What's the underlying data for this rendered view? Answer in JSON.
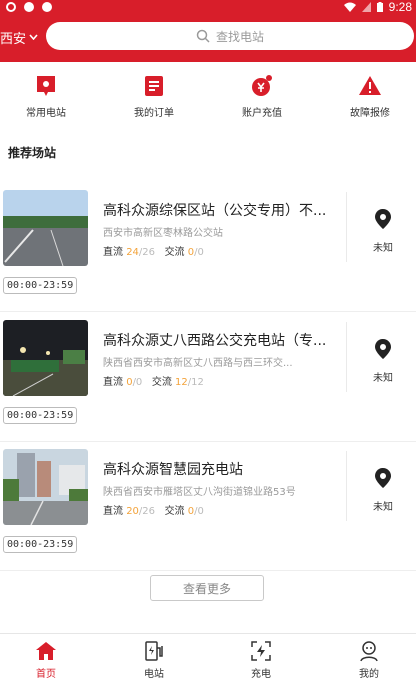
{
  "status_bar": {
    "time": "9:28"
  },
  "header": {
    "city": "西安",
    "search_placeholder": "查找电站"
  },
  "quick_actions": [
    {
      "label": "常用电站",
      "icon": "bookmark-station-icon"
    },
    {
      "label": "我的订单",
      "icon": "order-list-icon"
    },
    {
      "label": "账户充值",
      "icon": "wallet-recharge-icon"
    },
    {
      "label": "故障报修",
      "icon": "warning-icon"
    }
  ],
  "section_title": "推荐场站",
  "stations": [
    {
      "name": "高科众源综保区站（公交专用）不...",
      "address": "西安市高新区枣林路公交站",
      "dc_label": "直流",
      "dc_available": "24",
      "dc_total": "/26",
      "ac_label": "交流",
      "ac_available": "0",
      "ac_total": "/0",
      "distance_status": "未知",
      "hours": "00:00-23:59"
    },
    {
      "name": "高科众源丈八西路公交充电站（专...",
      "address": "陕西省西安市高新区丈八西路与西三环交...",
      "dc_label": "直流",
      "dc_available": "0",
      "dc_total": "/0",
      "ac_label": "交流",
      "ac_available": "12",
      "ac_total": "/12",
      "distance_status": "未知",
      "hours": "00:00-23:59"
    },
    {
      "name": "高科众源智慧园充电站",
      "address": "陕西省西安市雁塔区丈八沟街道锦业路53号",
      "dc_label": "直流",
      "dc_available": "20",
      "dc_total": "/26",
      "ac_label": "交流",
      "ac_available": "0",
      "ac_total": "/0",
      "distance_status": "未知",
      "hours": "00:00-23:59"
    }
  ],
  "more_button": "查看更多",
  "tabbar": [
    {
      "label": "首页",
      "icon": "home-icon",
      "active": true
    },
    {
      "label": "电站",
      "icon": "charging-station-icon",
      "active": false
    },
    {
      "label": "充电",
      "icon": "scan-charge-icon",
      "active": false
    },
    {
      "label": "我的",
      "icon": "profile-icon",
      "active": false
    }
  ],
  "colors": {
    "brand_red": "#d81e2a",
    "available_orange": "#f3a33b"
  }
}
